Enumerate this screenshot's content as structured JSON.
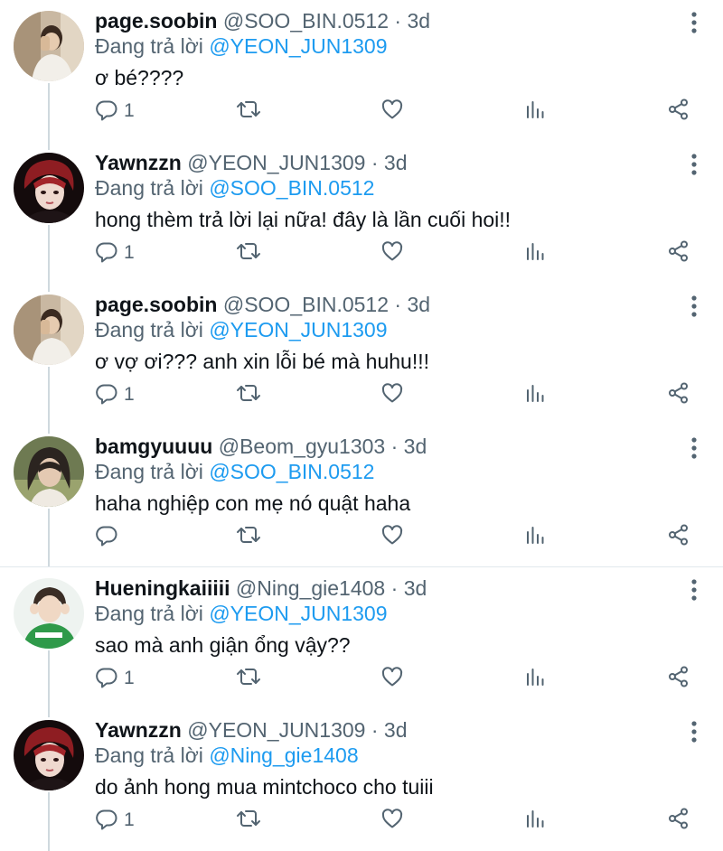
{
  "replying_label": "Đang trả lời",
  "tweets": [
    {
      "display_name": "page.soobin",
      "handle": "@SOO_BIN.0512",
      "separator": "·",
      "time": "3d",
      "replying_to": "@YEON_JUN1309",
      "text": "ơ bé????",
      "reply_count": "1",
      "avatar": "page-soobin-avatar"
    },
    {
      "display_name": "Yawnzzn",
      "handle": "@YEON_JUN1309",
      "separator": "·",
      "time": "3d",
      "replying_to": "@SOO_BIN.0512",
      "text": "hong thèm trả lời lại nữa! đây là lần cuối hoi!!",
      "reply_count": "1",
      "avatar": "yawnzzn-avatar"
    },
    {
      "display_name": "page.soobin",
      "handle": "@SOO_BIN.0512",
      "separator": "·",
      "time": "3d",
      "replying_to": "@YEON_JUN1309",
      "text": "ơ vợ ơi??? anh xin lỗi bé mà huhu!!!",
      "reply_count": "1",
      "avatar": "page-soobin-avatar"
    },
    {
      "display_name": "bamgyuuuu",
      "handle": "@Beom_gyu1303",
      "separator": "·",
      "time": "3d",
      "replying_to": "@SOO_BIN.0512",
      "text": "haha nghiệp con mẹ nó quật haha",
      "reply_count": "",
      "avatar": "bamgyuuuu-avatar"
    },
    {
      "display_name": "Hueningkaiiiii",
      "handle": "@Ning_gie1408",
      "separator": "·",
      "time": "3d",
      "replying_to": "@YEON_JUN1309",
      "text": "sao mà anh giận ổng vậy??",
      "reply_count": "1",
      "avatar": "hueningkai-avatar"
    },
    {
      "display_name": "Yawnzzn",
      "handle": "@YEON_JUN1309",
      "separator": "·",
      "time": "3d",
      "replying_to": "@Ning_gie1408",
      "text": "do ảnh hong mua mintchoco cho tuiii",
      "reply_count": "1",
      "avatar": "yawnzzn-avatar"
    }
  ],
  "colors": {
    "text": "#0f1419",
    "secondary": "#536471",
    "mention": "#1d9bf0",
    "thread_line": "#cfd9de",
    "divider": "#e1e8ed"
  },
  "icons": [
    "more-vertical-icon",
    "reply-icon",
    "retweet-icon",
    "like-icon",
    "stats-icon",
    "share-icon"
  ]
}
